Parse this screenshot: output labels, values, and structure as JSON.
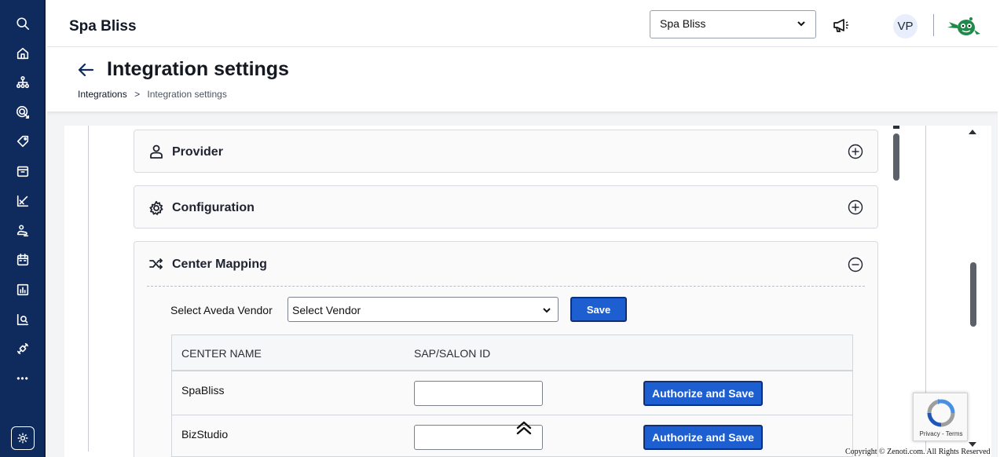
{
  "header": {
    "app_title": "Spa Bliss",
    "org_selected": "Spa Bliss",
    "avatar_initials": "VP"
  },
  "page": {
    "title": "Integration settings",
    "breadcrumb": {
      "parent": "Integrations",
      "separator": ">",
      "current": "Integration settings"
    }
  },
  "sidebar": {
    "icons": [
      "search-icon",
      "home-icon",
      "org-chart-icon",
      "target-icon",
      "tag-icon",
      "box-icon",
      "chart-icon",
      "service-icon",
      "calendar-icon",
      "report-icon",
      "analytics-icon",
      "integration-icon",
      "more-icon"
    ],
    "more_label": "•••"
  },
  "sections": {
    "provider": {
      "title": "Provider"
    },
    "configuration": {
      "title": "Configuration"
    },
    "center_mapping": {
      "title": "Center Mapping",
      "vendor_label": "Select Aveda Vendor",
      "vendor_selected": "Select Vendor",
      "save_label": "Save",
      "table": {
        "columns": [
          "CENTER NAME",
          "SAP/SALON ID"
        ],
        "rows": [
          {
            "center_name": "SpaBliss",
            "sap_id": "",
            "action_label": "Authorize and Save"
          },
          {
            "center_name": "BizStudio",
            "sap_id": "",
            "action_label": "Authorize and Save"
          }
        ]
      }
    }
  },
  "recaptcha": {
    "text": "Privacy - Terms"
  },
  "footer": {
    "copyright": "Copyright © Zenoti.com. All Rights Reserved"
  },
  "colors": {
    "sidebar_bg": "#0f2a5c",
    "primary_button": "#1d5fd1",
    "button_border": "#0f2f7a"
  }
}
